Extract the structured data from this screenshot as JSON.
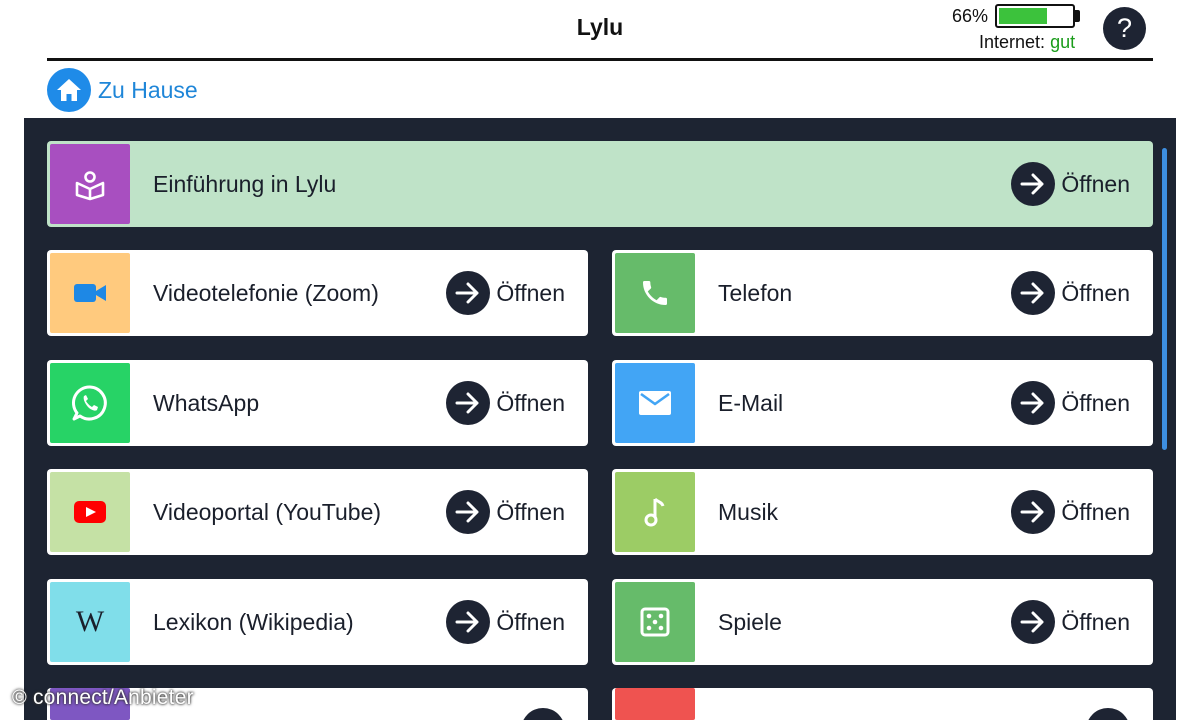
{
  "header": {
    "title": "Lylu",
    "battery_percent": "66%",
    "battery_level": 0.66,
    "internet_label": "Internet:",
    "internet_status": "gut",
    "help_label": "?"
  },
  "nav": {
    "home_label": "Zu Hause"
  },
  "apps": [
    {
      "label": "Einführung in Lylu",
      "open_label": "Öffnen",
      "icon": "book-reader-icon",
      "color": "#a84fc0"
    },
    {
      "label": "Videotelefonie (Zoom)",
      "open_label": "Öffnen",
      "icon": "video-camera-icon",
      "color": "#ffca7e"
    },
    {
      "label": "Telefon",
      "open_label": "Öffnen",
      "icon": "phone-icon",
      "color": "#66bb6a"
    },
    {
      "label": "WhatsApp",
      "open_label": "Öffnen",
      "icon": "whatsapp-icon",
      "color": "#27d366"
    },
    {
      "label": "E-Mail",
      "open_label": "Öffnen",
      "icon": "mail-icon",
      "color": "#42a5f5"
    },
    {
      "label": "Videoportal (YouTube)",
      "open_label": "Öffnen",
      "icon": "youtube-icon",
      "color": "#c5e1a5"
    },
    {
      "label": "Musik",
      "open_label": "Öffnen",
      "icon": "music-note-icon",
      "color": "#9ccc65"
    },
    {
      "label": "Lexikon (Wikipedia)",
      "open_label": "Öffnen",
      "icon": "wikipedia-icon",
      "color": "#80deea"
    },
    {
      "label": "Spiele",
      "open_label": "Öffnen",
      "icon": "dice-icon",
      "color": "#66bb6a"
    },
    {
      "label": "",
      "open_label": "",
      "icon": "partial-tile-icon",
      "color": "#7e57c2"
    },
    {
      "label": "",
      "open_label": "",
      "icon": "partial-tile-icon",
      "color": "#ef5350"
    }
  ],
  "watermark": {
    "copyright": "©",
    "text": "connect/Anbieter"
  }
}
